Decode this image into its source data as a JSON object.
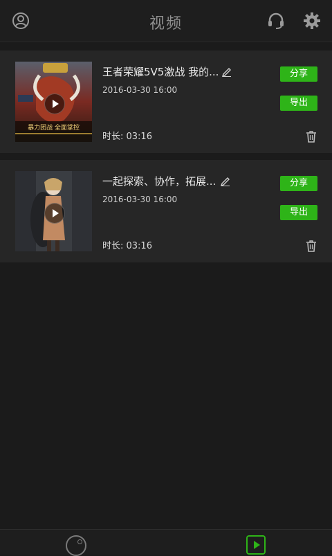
{
  "header": {
    "title": "视频",
    "icons": [
      "user-icon",
      "headset-icon",
      "gear-icon"
    ]
  },
  "videos": [
    {
      "title": "王者荣耀5V5激战 我的...",
      "date": "2016-03-30  16:00",
      "duration": "时长: 03:16",
      "share_label": "分享",
      "export_label": "导出",
      "thumbnail_caption": "暴力团战 全面掌控"
    },
    {
      "title": "一起探索、协作，拓展...",
      "date": "2016-03-30  16:00",
      "duration": "时长: 03:16",
      "share_label": "分享",
      "export_label": "导出"
    }
  ],
  "bottom_tabs": [
    {
      "icon": "capture-icon",
      "active": false
    },
    {
      "icon": "video-play-icon",
      "active": true
    }
  ],
  "colors": {
    "accent": "#2eb418",
    "background": "#1b1b1b",
    "card": "#262626"
  }
}
